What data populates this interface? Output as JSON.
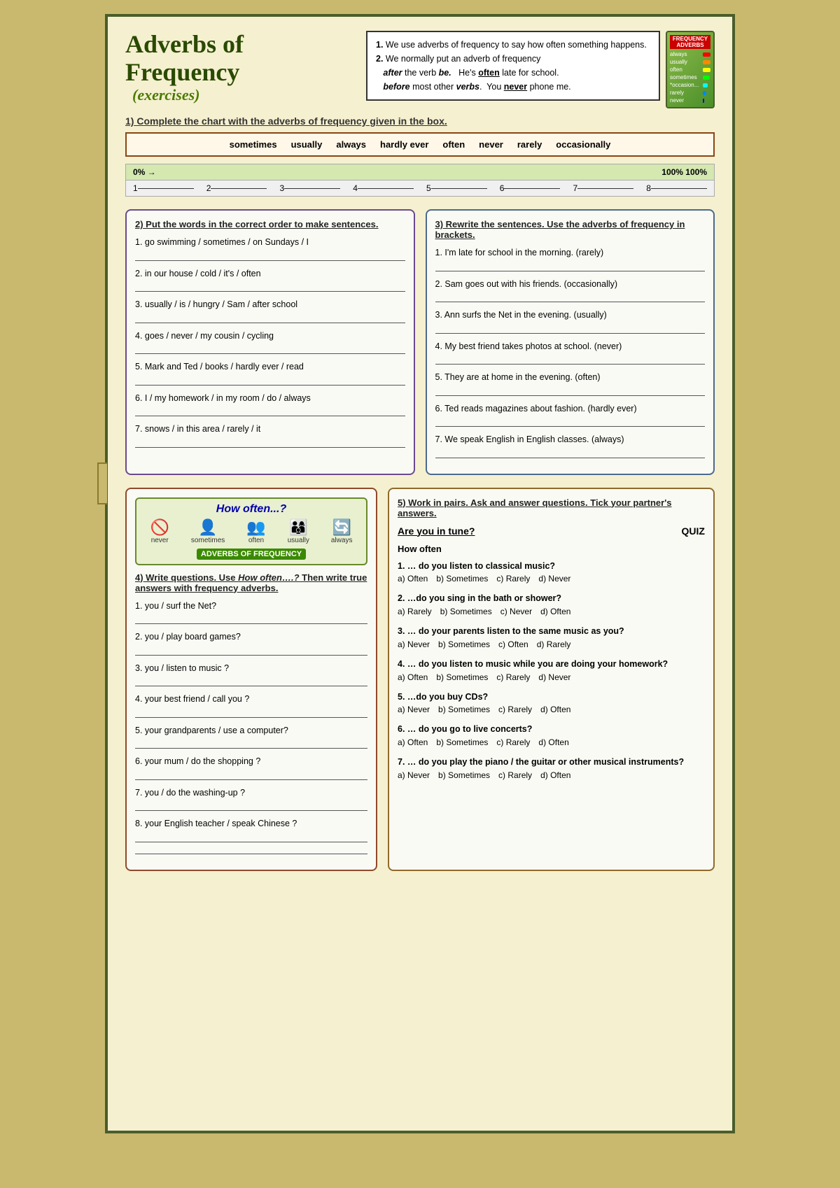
{
  "title": {
    "main": "Adverbs of Frequency",
    "sub": "(exercises)"
  },
  "info": {
    "line1": "1. We use adverbs of frequency to say how often something happens.",
    "line2": "2. We normally put an adverb of frequency",
    "line3a": "after",
    "line3b": " the verb ",
    "line3c": "be.",
    "line3d": "   He's ",
    "line3e": "often",
    "line3f": " late for school.",
    "line4a": "before",
    "line4b": " most other ",
    "line4c": "verbs",
    "line4d": ".  You ",
    "line4e": "never",
    "line4f": " phone me."
  },
  "section1": {
    "title": "1) Complete the chart with the adverbs of frequency given in the box.",
    "words": [
      "sometimes",
      "usually",
      "always",
      "hardly ever",
      "often",
      "never",
      "rarely",
      "occasionally"
    ],
    "percent_low": "0%",
    "arrow": "→",
    "percent_high": "100%  100%",
    "numbers": [
      "1",
      "2",
      "3",
      "4",
      "5",
      "6",
      "7",
      "8"
    ]
  },
  "section2": {
    "title": "2) Put the words in the correct order to make sentences.",
    "items": [
      "1. go swimming / sometimes / on Sundays / I",
      "2. in our house / cold / it's / often",
      "3. usually / is / hungry / Sam / after school",
      "4. goes / never / my cousin / cycling",
      "5. Mark and Ted / books / hardly ever / read",
      "6. I / my homework / in my room / do / always",
      "7. snows / in this area / rarely / it"
    ]
  },
  "section3": {
    "title": "3) Rewrite the sentences. Use the adverbs of frequency in brackets.",
    "items": [
      "1. I'm late for school in the morning. (rarely)",
      "2. Sam goes out with his friends. (occasionally)",
      "3. Ann surfs the Net in the evening. (usually)",
      "4. My best friend takes photos at school. (never)",
      "5. They are at home in the evening. (often)",
      "6. Ted reads magazines about fashion. (hardly ever)",
      "7. We speak English in English classes. (always)"
    ]
  },
  "section4": {
    "title": "4) Write questions. Use How often….? Then write true answers with frequency adverbs.",
    "how_often_title": "How often...?",
    "adv_label": "ADVERBS OF FREQUENCY",
    "items": [
      "1. you / surf the Net?",
      "2. you /  play board games?",
      "3. you / listen to music ?",
      "4. your best friend / call you ?",
      "5. your grandparents / use a computer?",
      "6. your mum / do the shopping ?",
      "7. you / do the washing-up ?",
      "8. your English teacher / speak Chinese ?"
    ]
  },
  "section5": {
    "title": "5) Work in pairs. Ask and answer questions. Tick your partner's answers.",
    "quiz_title": "Are you in tune?",
    "quiz_label": "QUIZ",
    "how_often": "How often",
    "questions": [
      {
        "q": "1. … do you listen to classical music?",
        "options": [
          "a) Often",
          "b) Sometimes",
          "c) Rarely",
          "d) Never"
        ]
      },
      {
        "q": "2. …do you sing in the bath or shower?",
        "options": [
          "a) Rarely",
          "b) Sometimes",
          "c) Never",
          "d) Often"
        ]
      },
      {
        "q": "3. … do your parents listen to the same music as you?",
        "options": [
          "a) Never",
          "b) Sometimes",
          "c) Often",
          "d) Rarely"
        ]
      },
      {
        "q": "4. … do you listen to music while you are doing your homework?",
        "options": [
          "a) Often",
          "b) Sometimes",
          "c) Rarely",
          "d) Never"
        ]
      },
      {
        "q": "5. …do you buy CDs?",
        "options": [
          "a) Never",
          "b) Sometimes",
          "c) Rarely",
          "d) Often"
        ]
      },
      {
        "q": "6. … do you go to live concerts?",
        "options": [
          "a) Often",
          "b) Sometimes",
          "c) Rarely",
          "d) Often"
        ]
      },
      {
        "q": "7. … do you play the piano / the guitar or other musical instruments?",
        "options": [
          "a) Never",
          "b) Sometimes",
          "c) Rarely",
          "d) Often"
        ]
      }
    ]
  }
}
